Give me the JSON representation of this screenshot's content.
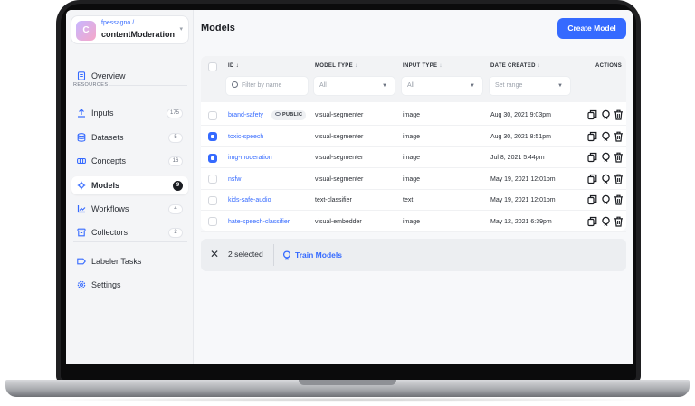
{
  "colors": {
    "accent": "#356AFF",
    "dark": "#1b1d22"
  },
  "app": {
    "user": "fpessagno",
    "name": "contentModeration",
    "avatar_letter": "C"
  },
  "sidebar": {
    "overview": "Overview",
    "section_label": "RESOURCES",
    "items": [
      {
        "label": "Inputs",
        "count": "175",
        "icon": "upload-icon"
      },
      {
        "label": "Datasets",
        "count": "5",
        "icon": "database-icon"
      },
      {
        "label": "Concepts",
        "count": "16",
        "icon": "concepts-icon"
      },
      {
        "label": "Models",
        "count": "9",
        "icon": "model-icon",
        "active": true
      },
      {
        "label": "Workflows",
        "count": "4",
        "icon": "workflow-icon"
      },
      {
        "label": "Collectors",
        "count": "2",
        "icon": "collector-icon"
      }
    ],
    "labeler_tasks": "Labeler Tasks",
    "settings": "Settings"
  },
  "main": {
    "title": "Models",
    "create_button": "Create Model",
    "columns": {
      "id": "ID",
      "model_type": "MODEL TYPE",
      "input_type": "INPUT TYPE",
      "date_created": "DATE CREATED",
      "actions": "ACTIONS"
    },
    "filters": {
      "id_placeholder": "Filter by name",
      "model_type": "All",
      "input_type": "All",
      "date": "Set range"
    },
    "public_badge": "PUBLIC",
    "rows": [
      {
        "id": "brand-safety",
        "model_type": "visual-segmenter",
        "input_type": "image",
        "date": "Aug 30, 2021 9:03pm",
        "selected": false,
        "public": true
      },
      {
        "id": "toxic-speech",
        "model_type": "visual-segmenter",
        "input_type": "image",
        "date": "Aug 30, 2021 8:51pm",
        "selected": true,
        "public": false
      },
      {
        "id": "img-moderation",
        "model_type": "visual-segmenter",
        "input_type": "image",
        "date": "Jul 8, 2021 5:44pm",
        "selected": true,
        "public": false
      },
      {
        "id": "nsfw",
        "model_type": "visual-segmenter",
        "input_type": "image",
        "date": "May 19, 2021 12:01pm",
        "selected": false,
        "public": false
      },
      {
        "id": "kids-safe-audio",
        "model_type": "text-classifier",
        "input_type": "text",
        "date": "May 19, 2021 12:01pm",
        "selected": false,
        "public": false
      },
      {
        "id": "hate-speech-classifier",
        "model_type": "visual-embedder",
        "input_type": "image",
        "date": "May 12, 2021 6:39pm",
        "selected": false,
        "public": false
      }
    ],
    "selection": {
      "count_label": "2 selected",
      "train_label": "Train Models"
    }
  }
}
